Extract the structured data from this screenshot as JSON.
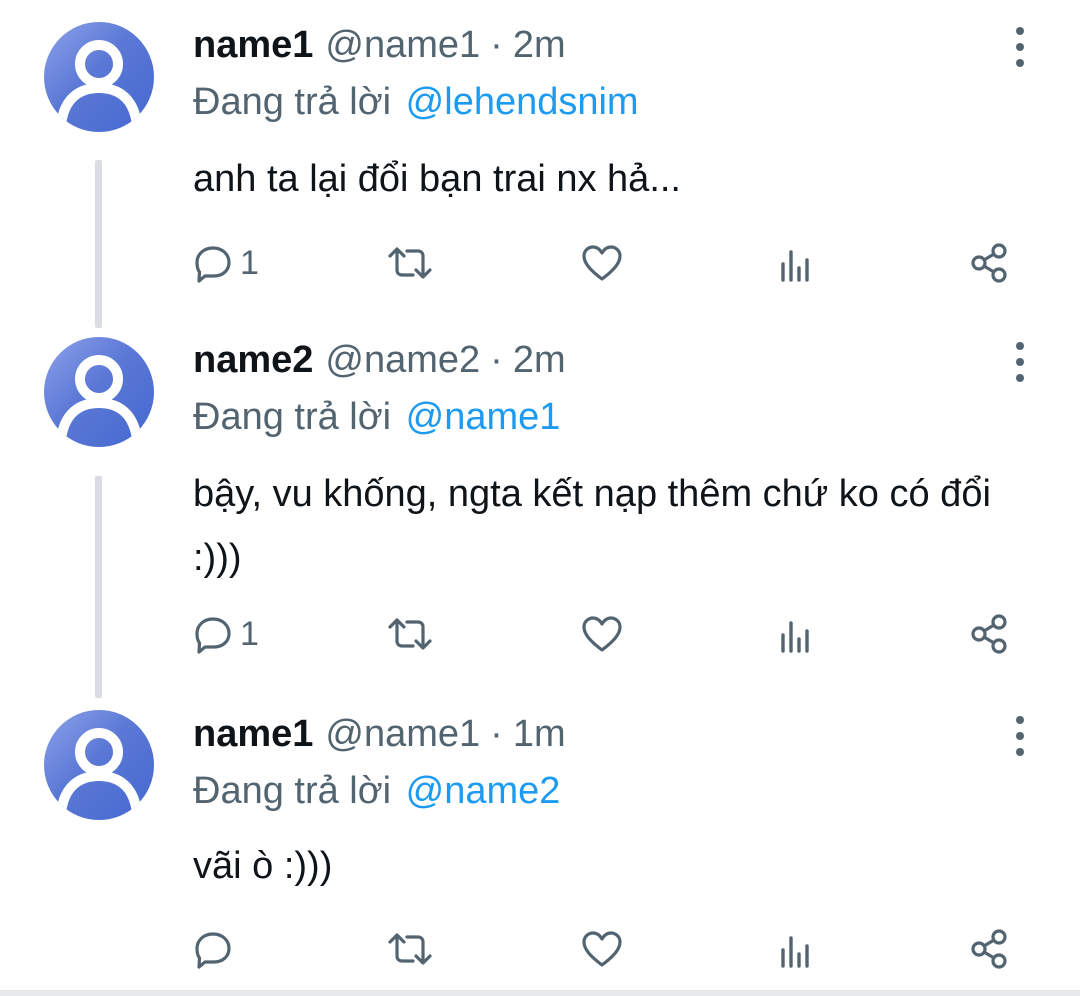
{
  "replying_prefix": "Đang trả lời",
  "tweets": [
    {
      "display_name": "name1",
      "handle": "@name1",
      "separator": "·",
      "time": "2m",
      "replying_to": "@lehendsnim",
      "text": "anh ta lại đổi bạn trai nx hả...",
      "reply_count": "1"
    },
    {
      "display_name": "name2",
      "handle": "@name2",
      "separator": "·",
      "time": "2m",
      "replying_to": "@name1",
      "text": "bậy, vu khống, ngta kết nạp thêm chứ ko có đổi :)))",
      "reply_count": "1"
    },
    {
      "display_name": "name1",
      "handle": "@name1",
      "separator": "·",
      "time": "1m",
      "replying_to": "@name2",
      "text": "vãi ò :)))",
      "reply_count": ""
    }
  ],
  "icons": {
    "reply": "reply-icon",
    "retweet": "retweet-icon",
    "like": "heart-icon",
    "views": "views-icon",
    "share": "share-icon",
    "more": "more-vertical-icon",
    "avatar": "default-avatar-icon"
  },
  "colors": {
    "link": "#1d9bf0",
    "secondary_text": "#536471",
    "primary_text": "#0f1419",
    "avatar": "#5b78d6",
    "thread_line": "#d9dde1"
  }
}
